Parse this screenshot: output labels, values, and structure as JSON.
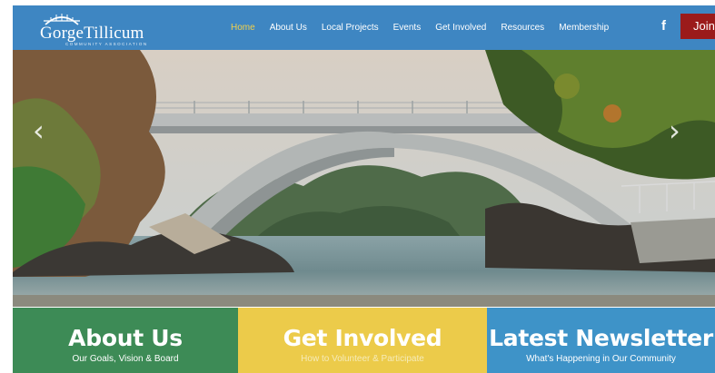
{
  "header": {
    "logo": {
      "name": "GorgeTillicum",
      "subtitle": "COMMUNITY ASSOCIATION"
    },
    "nav": [
      {
        "label": "Home",
        "active": true
      },
      {
        "label": "About Us",
        "active": false
      },
      {
        "label": "Local Projects",
        "active": false
      },
      {
        "label": "Events",
        "active": false
      },
      {
        "label": "Get Involved",
        "active": false
      },
      {
        "label": "Resources",
        "active": false
      },
      {
        "label": "Membership",
        "active": false
      }
    ],
    "facebook_icon": "f",
    "join_label": "Join",
    "colors": {
      "header": "#3e86c2",
      "active_nav": "#f2d04a",
      "join": "#9b1b1b"
    }
  },
  "hero": {
    "prev_arrow": "‹",
    "next_arrow": "›"
  },
  "cards": [
    {
      "title": "About Us",
      "subtitle": "Our Goals, Vision & Board",
      "color": "#3d8b56"
    },
    {
      "title": "Get Involved",
      "subtitle": "How to Volunteer & Participate",
      "color": "#eccb4a"
    },
    {
      "title": "Latest Newsletter",
      "subtitle": "What's Happening in Our Community",
      "color": "#3e93c8"
    }
  ]
}
